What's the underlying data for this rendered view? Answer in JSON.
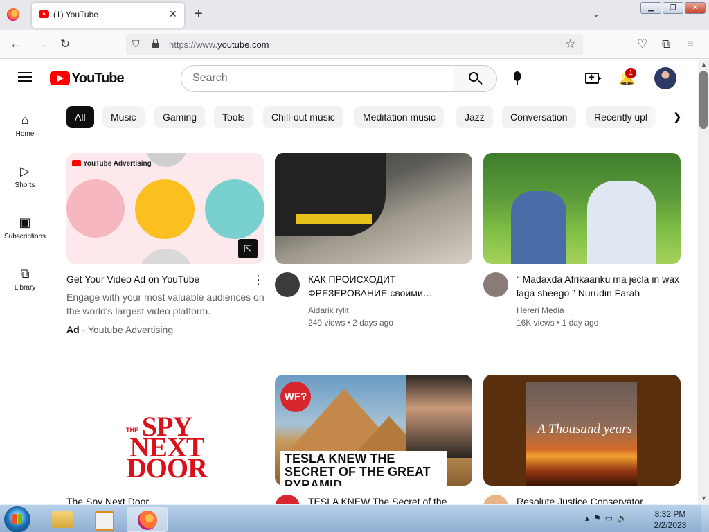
{
  "browser": {
    "tab_title": "(1) YouTube",
    "url_prefix": "https://www.",
    "url_domain": "youtube.com"
  },
  "youtube": {
    "logo_text": "YouTube",
    "search_placeholder": "Search",
    "notification_count": "1",
    "sidebar": [
      {
        "label": "Home"
      },
      {
        "label": "Shorts"
      },
      {
        "label": "Subscriptions"
      },
      {
        "label": "Library"
      }
    ],
    "chips": [
      "All",
      "Music",
      "Gaming",
      "Tools",
      "Chill-out music",
      "Meditation music",
      "Jazz",
      "Conversation",
      "Recently upl"
    ],
    "ad": {
      "brand_label": "YouTube Advertising",
      "title": "Get Your Video Ad on YouTube",
      "description": "Engage with your most valuable audiences on the world's largest video platform.",
      "ad_label": "Ad",
      "separator": "·",
      "sponsor": "Youtube Advertising"
    },
    "videos": [
      {
        "title": "КАК ПРОИСХОДИТ ФРЕЗЕРОВАНИЕ своими…",
        "channel": "Aidarik rylit",
        "views": "249 views",
        "age": "2 days ago"
      },
      {
        "title": "“ Madaxda Afrikaanku ma jecla in wax laga sheego ” Nurudin Farah",
        "channel": "Hereri Media",
        "views": "16K views",
        "age": "1 day ago"
      },
      {
        "title": "The Spy Next Door",
        "thumb_text_the": "THE",
        "thumb_text_main": "SPY NEXT DOOR"
      },
      {
        "title": "TESLA KNEW The Secret of the",
        "thumb_badge": "WF?",
        "thumb_text": "TESLA KNEW THE SECRET OF THE GREAT PYRAMID"
      },
      {
        "title": "Resolute Justice Conservator",
        "thumb_text": "A Thousand years"
      }
    ]
  },
  "taskbar": {
    "time": "8:32 PM",
    "date": "2/2/2023"
  },
  "colors": {
    "youtube_red": "#ff0000",
    "chip_active_bg": "#0f0f0f",
    "chip_bg": "#f2f2f2",
    "notification_badge": "#cc0000"
  }
}
